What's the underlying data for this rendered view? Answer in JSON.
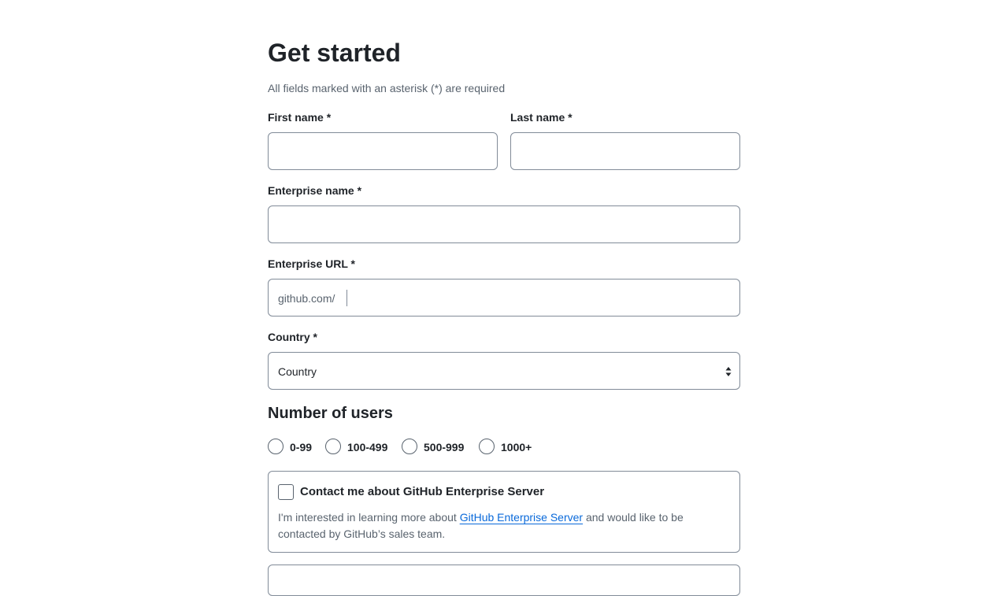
{
  "form": {
    "title": "Get started",
    "required_hint": "All fields marked with an asterisk (*) are required",
    "first_name": {
      "label": "First name *",
      "value": ""
    },
    "last_name": {
      "label": "Last name *",
      "value": ""
    },
    "enterprise_name": {
      "label": "Enterprise name *",
      "value": ""
    },
    "enterprise_url": {
      "label": "Enterprise URL *",
      "prefix": "github.com/",
      "value": ""
    },
    "country": {
      "label": "Country *",
      "selected": "Country"
    },
    "users": {
      "title": "Number of users",
      "options": [
        "0-99",
        "100-499",
        "500-999",
        "1000+"
      ]
    },
    "contact": {
      "title": "Contact me about GitHub Enterprise Server",
      "desc_before": "I'm interested in learning more about ",
      "link_text": "GitHub Enterprise Server",
      "desc_after": " and would like to be contacted by GitHub’s sales team."
    }
  },
  "colors": {
    "text": "#1f2328",
    "muted": "#59636e",
    "border": "#818b98",
    "link": "#0969da"
  },
  "icons": {
    "select_caret": "caret-up-down-icon"
  }
}
